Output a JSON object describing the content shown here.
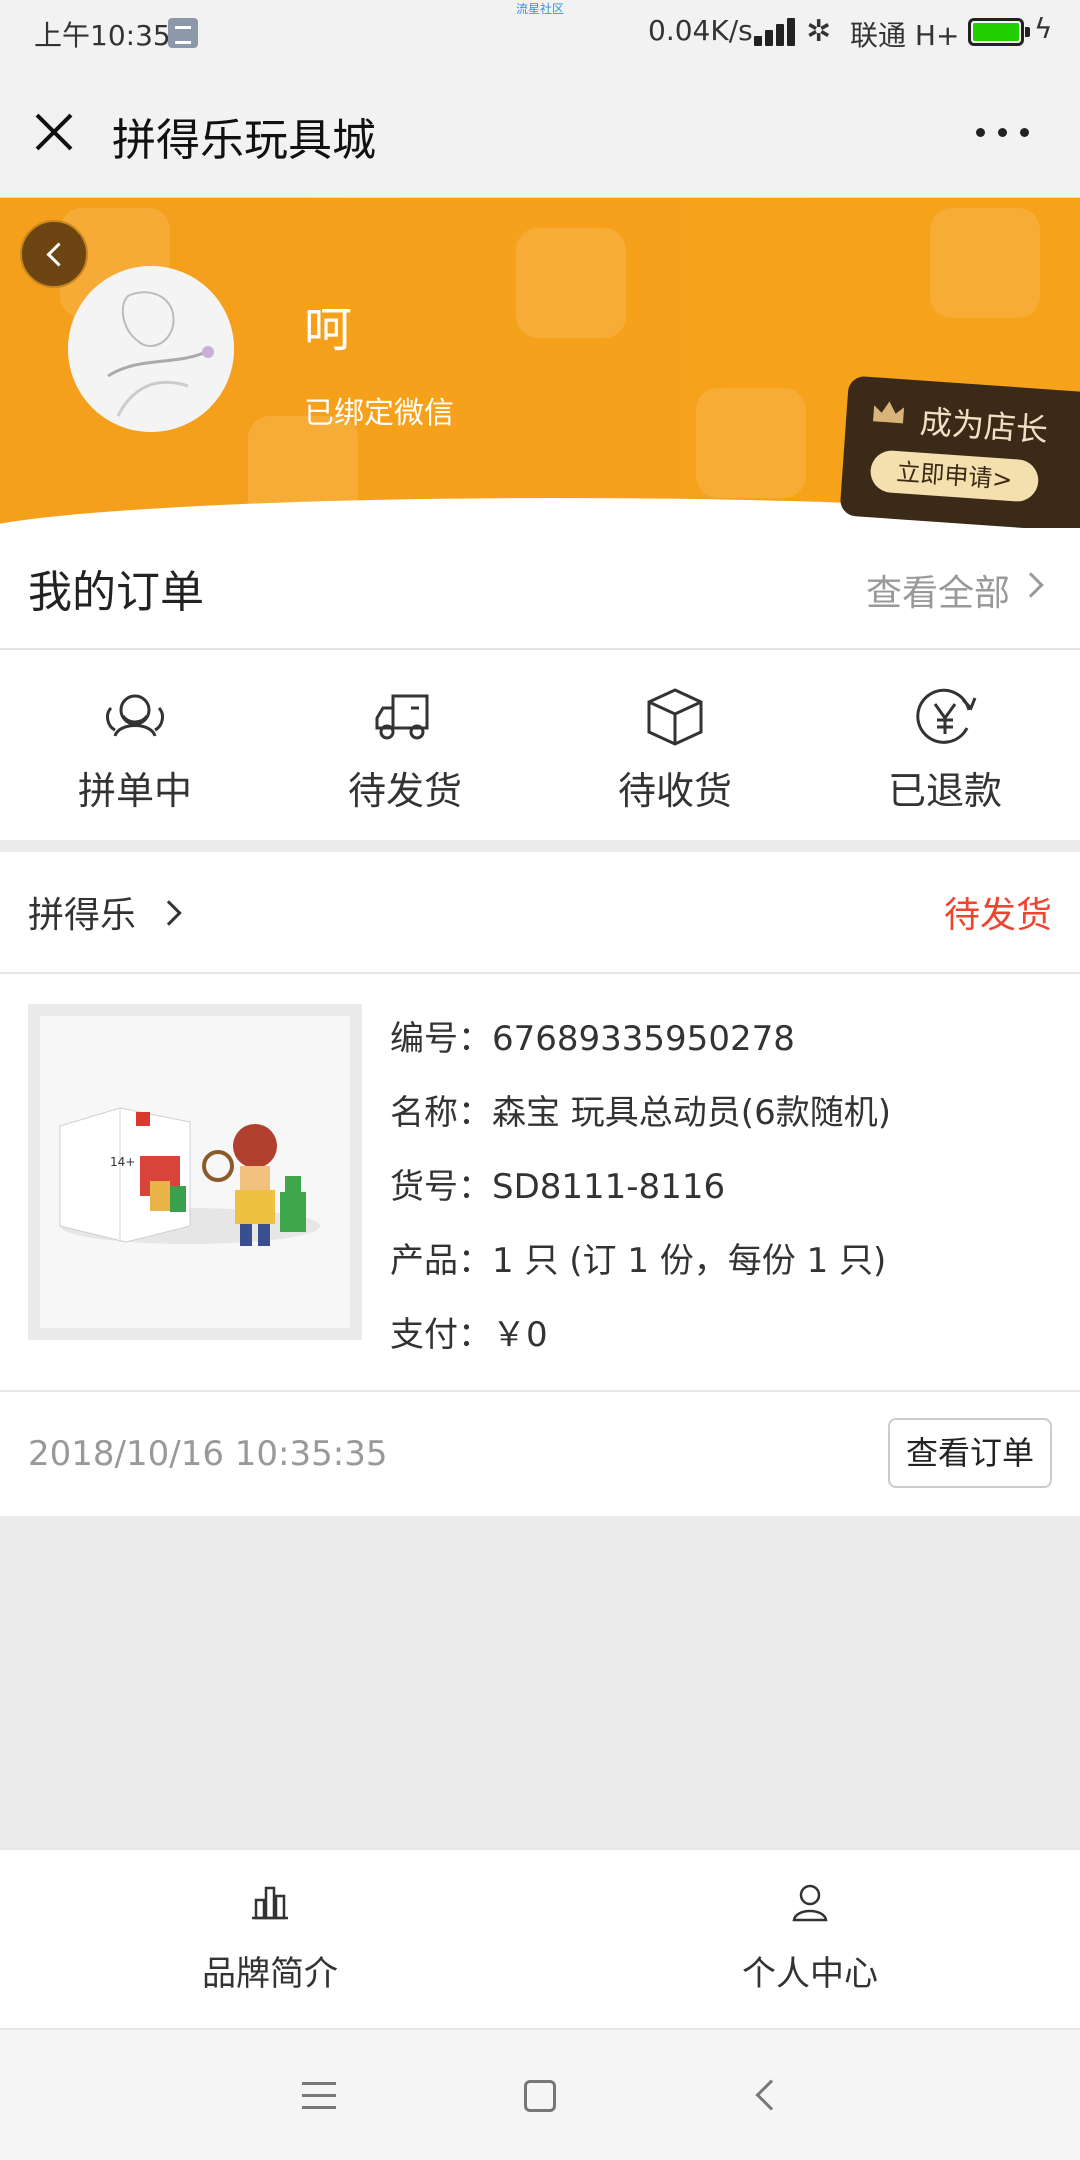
{
  "status_bar": {
    "time": "上午10:35",
    "speed": "0.04K/s",
    "carrier": "联通 H+",
    "tiny_text": "流星社区"
  },
  "title_bar": {
    "title": "拼得乐玩具城"
  },
  "profile": {
    "username": "呵",
    "bind_status": "已绑定微信",
    "shop_owner": {
      "label": "成为店长",
      "apply": "立即申请>"
    }
  },
  "orders_section": {
    "title": "我的订单",
    "view_all": "查看全部",
    "statuses": [
      {
        "label": "拼单中",
        "icon": "group-icon"
      },
      {
        "label": "待发货",
        "icon": "truck-icon"
      },
      {
        "label": "待收货",
        "icon": "box-icon"
      },
      {
        "label": "已退款",
        "icon": "yen-icon"
      }
    ]
  },
  "order": {
    "shop": "拼得乐",
    "status": "待发货",
    "lines": [
      "编号：67689335950278",
      "名称：森宝 玩具总动员(6款随机)",
      "货号：SD8111-8116",
      "产品：1 只 (订 1 份，每份 1 只)",
      "支付：￥0"
    ],
    "time": "2018/10/16 10:35:35",
    "view_button": "查看订单"
  },
  "tabbar": {
    "items": [
      {
        "label": "品牌简介",
        "icon": "chart-icon"
      },
      {
        "label": "个人中心",
        "icon": "person-icon"
      }
    ]
  },
  "colors": {
    "banner": "#f5a01c",
    "accent_red": "#f0442f"
  }
}
